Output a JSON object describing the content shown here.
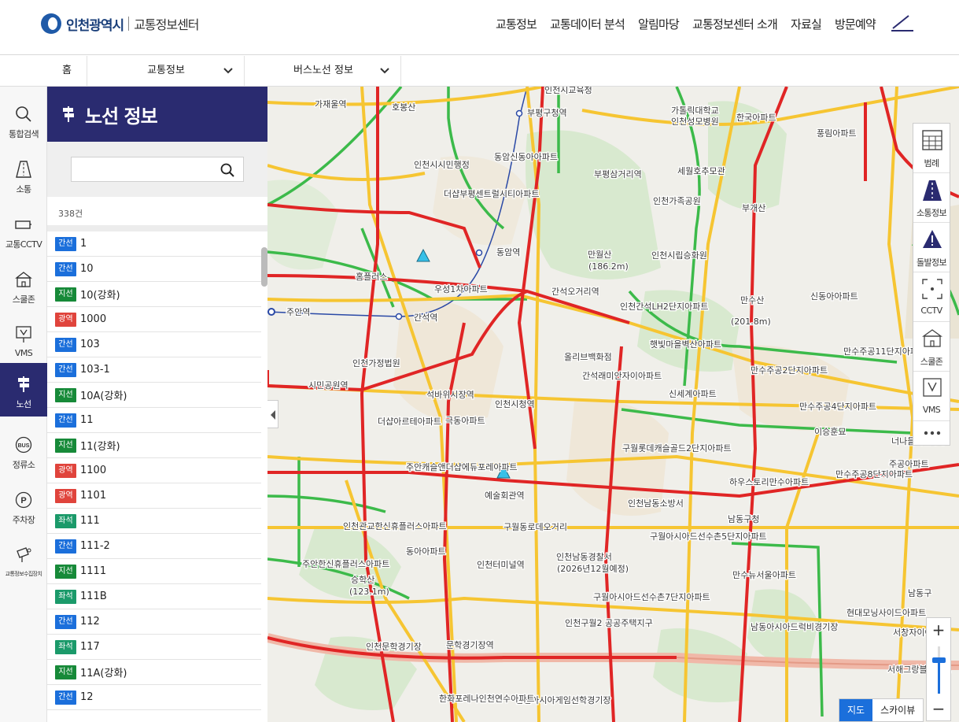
{
  "header": {
    "logo_city": "인천광역시",
    "logo_center": "교통정보센터",
    "nav": [
      "교통정보",
      "교통데이터 분석",
      "알림마당",
      "교통정보센터 소개",
      "자료실",
      "방문예약"
    ]
  },
  "breadcrumb": {
    "home": "홈",
    "level1": "교통정보",
    "level2": "버스노선 정보"
  },
  "side_nav": [
    {
      "label": "통합검색",
      "icon": "search-icon"
    },
    {
      "label": "소통",
      "icon": "road-icon"
    },
    {
      "label": "교통CCTV",
      "icon": "cctv-icon"
    },
    {
      "label": "스쿨존",
      "icon": "school-icon"
    },
    {
      "label": "VMS",
      "icon": "vms-icon"
    },
    {
      "label": "노선",
      "icon": "route-sign-icon",
      "active": true
    },
    {
      "label": "정류소",
      "icon": "bus-stop-icon"
    },
    {
      "label": "주차장",
      "icon": "parking-icon"
    },
    {
      "label": "교통정보수집장치",
      "icon": "collector-icon"
    }
  ],
  "panel": {
    "title": "노선 정보",
    "search_value": "",
    "count": "338건",
    "routes": [
      {
        "type": "간선",
        "name": "1"
      },
      {
        "type": "간선",
        "name": "10"
      },
      {
        "type": "지선",
        "name": "10(강화)"
      },
      {
        "type": "광역",
        "name": "1000"
      },
      {
        "type": "간선",
        "name": "103"
      },
      {
        "type": "간선",
        "name": "103-1"
      },
      {
        "type": "지선",
        "name": "10A(강화)"
      },
      {
        "type": "간선",
        "name": "11"
      },
      {
        "type": "지선",
        "name": "11(강화)"
      },
      {
        "type": "광역",
        "name": "1100"
      },
      {
        "type": "광역",
        "name": "1101"
      },
      {
        "type": "좌석",
        "name": "111"
      },
      {
        "type": "간선",
        "name": "111-2"
      },
      {
        "type": "지선",
        "name": "1111"
      },
      {
        "type": "좌석",
        "name": "111B"
      },
      {
        "type": "간선",
        "name": "112"
      },
      {
        "type": "좌석",
        "name": "117"
      },
      {
        "type": "지선",
        "name": "11A(강화)"
      },
      {
        "type": "간선",
        "name": "12"
      }
    ]
  },
  "map_tools": [
    {
      "label": "범례",
      "icon": "legend-icon"
    },
    {
      "label": "소통정보",
      "icon": "traffic-road-icon"
    },
    {
      "label": "돌발정보",
      "icon": "warning-icon"
    },
    {
      "label": "CCTV",
      "icon": "cctv-frame-icon"
    },
    {
      "label": "스쿨존",
      "icon": "school-icon"
    },
    {
      "label": "VMS",
      "icon": "vms-icon"
    }
  ],
  "map": {
    "zoom_in": "+",
    "zoom_out": "−",
    "type_map": "지도",
    "type_sky": "스카이뷰",
    "labels": [
      "가재울역",
      "호봉산",
      "인천시교육청",
      "부평구청역",
      "가톨릭대학교",
      "인천성모병원",
      "한국아파트",
      "풍림아파트",
      "인천시시민행정",
      "동암신동아아파트",
      "세월호추모관",
      "부평삼거리역",
      "인천가족공원",
      "부개산",
      "동암역",
      "더샵부평센트럴시티아파트",
      "만월산",
      "(186.2m)",
      "인천시립승화원",
      "홈플러스",
      "우성1차아파트",
      "간석오거리역",
      "만수산",
      "(201.8m)",
      "신동아아파트",
      "주안역",
      "간석역",
      "인천간석LH2단지아파트",
      "햇빛마을벽산아파트",
      "만수주공11단지아파트",
      "인천가정법원",
      "올리브백화점",
      "만수주공2단지아파트",
      "간석래미안자이아파트",
      "신세계아파트",
      "만수주공4단지아파트",
      "이승훈묘",
      "시민공원역",
      "석바위시장역",
      "인천시청역",
      "예술회관역",
      "구월롯데캐슬골드2단지아파트",
      "하우스토리만수아파트",
      "만수주공8단지아파트",
      "남동구청",
      "인천남동소방서",
      "구월동로데오거리",
      "구월아시아드선수촌5단지아파트",
      "승학산",
      "(123.1m)",
      "인천터미널역",
      "만수뉴서울아파트",
      "남동구",
      "현대모닝사이드아파트",
      "인천문학경기장",
      "문학경기장역",
      "남동아시아드럭비경기장",
      "서창자이아파트",
      "인천아시아게임선학경기장",
      "한화포레나인천연수아파트",
      "인천구월2 공공주택지구",
      "서해그랑블아파트",
      "주공아파트",
      "너나들이캠핑장",
      "주안캐슬앤더샵에듀포레아파트",
      "인천관교한신휴플러스아파트",
      "주안한신휴플러스아파트",
      "동아아파트",
      "구월아시아드선수촌7단지아파트",
      "인천남동경찰서",
      "(2026년12월예정)",
      "더샵아르테아파트",
      "극동아파트"
    ]
  }
}
